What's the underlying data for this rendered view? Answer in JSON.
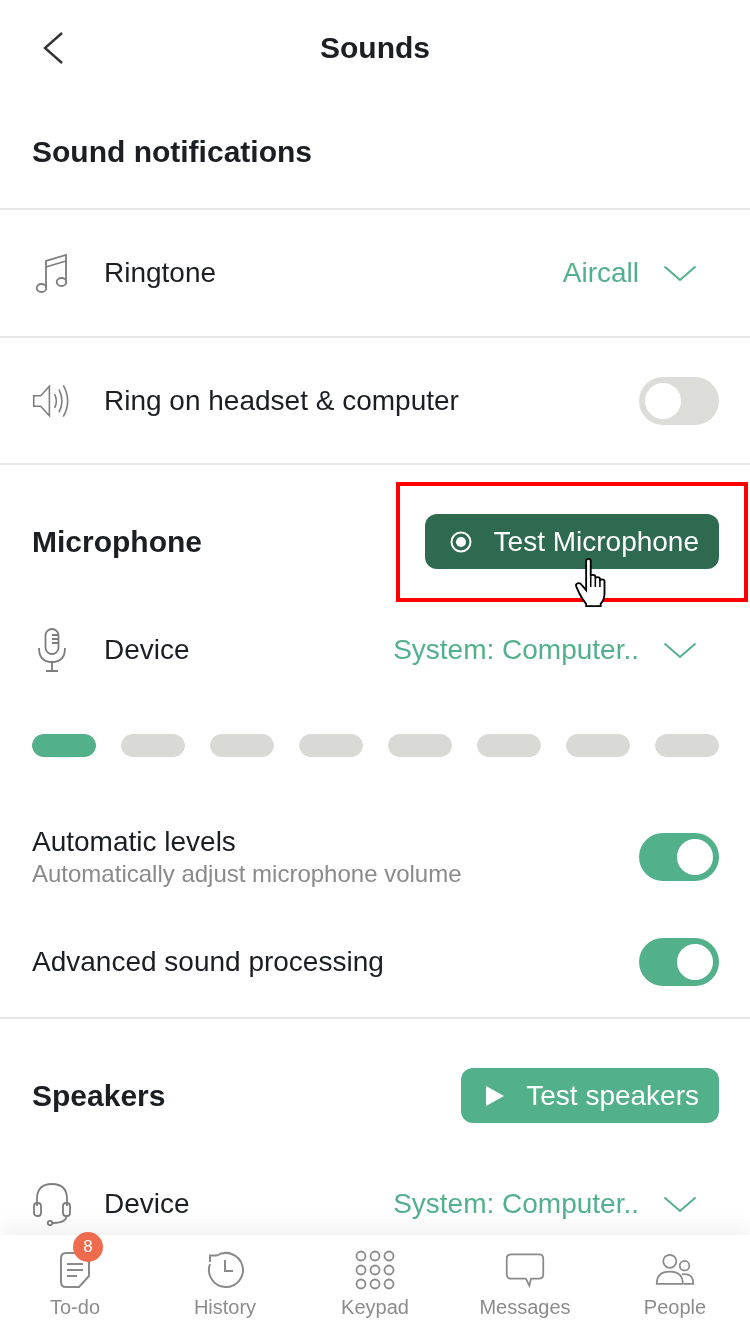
{
  "header": {
    "title": "Sounds"
  },
  "sound_notifications": {
    "title": "Sound notifications",
    "ringtone": {
      "label": "Ringtone",
      "value": "Aircall"
    },
    "ring_on_headset": {
      "label": "Ring on headset & computer",
      "on": false
    }
  },
  "microphone": {
    "title": "Microphone",
    "test_button": {
      "label": "Test Microphone",
      "highlighted": true,
      "hovered": true
    },
    "device": {
      "label": "Device",
      "value": "System: Computer.."
    },
    "meter": {
      "level": 0.093
    },
    "settings": [
      {
        "label": "Automatic levels",
        "description": "Automatically adjust microphone volume",
        "on": true
      },
      {
        "label": "Advanced sound processing",
        "on": true
      }
    ]
  },
  "speakers": {
    "title": "Speakers",
    "test_button": {
      "label": "Test speakers"
    },
    "device": {
      "label": "Device",
      "value": "System: Computer.."
    }
  },
  "nav": [
    {
      "label": "To-do",
      "badge": "8",
      "selected": false
    },
    {
      "label": "History",
      "selected": false
    },
    {
      "label": "Keypad",
      "selected": false
    },
    {
      "label": "Messages",
      "selected": false
    },
    {
      "label": "People",
      "selected": false
    }
  ]
}
